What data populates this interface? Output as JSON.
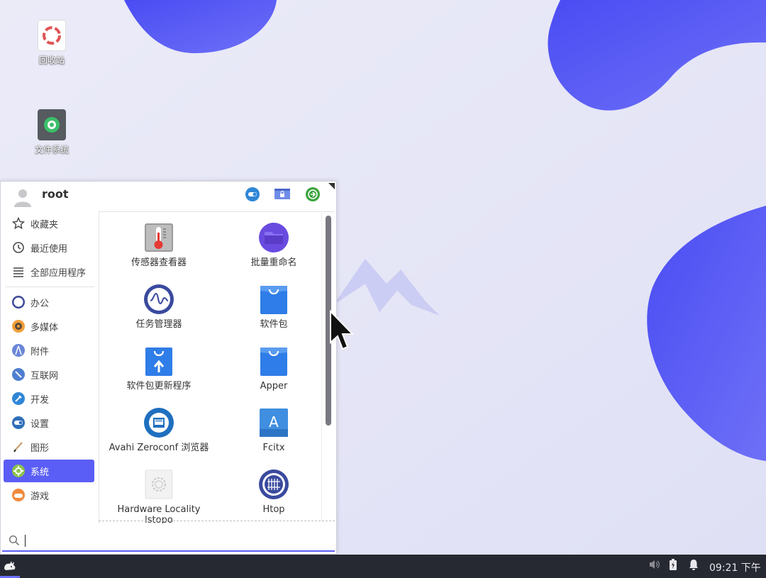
{
  "desktop": {
    "icons": [
      {
        "label": "回收站",
        "icon": "trash-icon"
      },
      {
        "label": "文件系统",
        "icon": "filesystem-icon"
      }
    ]
  },
  "menu": {
    "username": "root",
    "header_buttons": [
      "toggle-icon",
      "lock-screen-icon",
      "logout-icon"
    ],
    "sidebar": [
      {
        "label": "收藏夹",
        "icon": "star-icon"
      },
      {
        "label": "最近使用",
        "icon": "clock-icon"
      },
      {
        "label": "全部应用程序",
        "icon": "list-icon"
      },
      {
        "label": "办公",
        "icon": "office-icon"
      },
      {
        "label": "多媒体",
        "icon": "multimedia-icon"
      },
      {
        "label": "附件",
        "icon": "accessories-icon"
      },
      {
        "label": "互联网",
        "icon": "internet-icon"
      },
      {
        "label": "开发",
        "icon": "development-icon"
      },
      {
        "label": "设置",
        "icon": "settings-icon"
      },
      {
        "label": "图形",
        "icon": "graphics-icon"
      },
      {
        "label": "系统",
        "icon": "system-icon",
        "active": true
      },
      {
        "label": "游戏",
        "icon": "games-icon"
      }
    ],
    "apps": [
      {
        "label": "传感器查看器",
        "icon": "thermometer-icon"
      },
      {
        "label": "批量重命名",
        "icon": "folder-icon"
      },
      {
        "label": "任务管理器",
        "icon": "task-manager-icon"
      },
      {
        "label": "软件包",
        "icon": "package-bag-icon"
      },
      {
        "label": "软件包更新程序",
        "icon": "package-update-icon"
      },
      {
        "label": "Apper",
        "icon": "apper-bag-icon"
      },
      {
        "label": "Avahi Zeroconf 浏览器",
        "icon": "network-browser-icon"
      },
      {
        "label": "Fcitx",
        "icon": "fcitx-keyboard-icon"
      },
      {
        "label": "Hardware Locality\nlstopo",
        "icon": "hardware-gear-icon"
      },
      {
        "label": "Htop",
        "icon": "htop-icon"
      }
    ],
    "search": {
      "value": "",
      "placeholder": ""
    }
  },
  "taskbar": {
    "tray_icons": [
      "volume-icon",
      "battery-icon",
      "notification-bell-icon"
    ],
    "clock": "09:21 下午"
  },
  "colors": {
    "accent": "#5b5ef6",
    "wallpaper_blob": "#5254f5",
    "wallpaper_bg": "#e6e6f7",
    "taskbar_bg": "#272932"
  }
}
